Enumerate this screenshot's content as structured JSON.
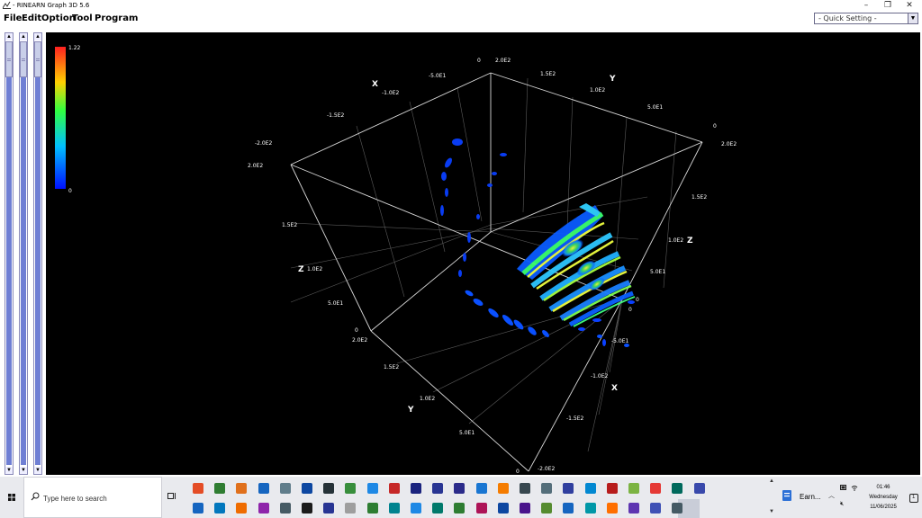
{
  "window": {
    "title": "- RINEARN Graph 3D 5.6",
    "minimize_glyph": "–",
    "maximize_glyph": "❐",
    "close_glyph": "✕"
  },
  "menu": {
    "items": [
      "File",
      "Edit",
      "Option",
      "Tool",
      "Program"
    ]
  },
  "quick_setting": {
    "value": "- Quick Setting -"
  },
  "colorbar": {
    "max_label": "1.22",
    "min_label": "0"
  },
  "axes": {
    "x_title": "X",
    "y_title": "Y",
    "z_title": "Z",
    "top_x_ticks": [
      "-2.0E2",
      "-1.5E2",
      "-1.0E2",
      "-5.0E1",
      "0"
    ],
    "top_y_ticks": [
      "2.0E2",
      "1.5E2",
      "1.0E2",
      "5.0E1",
      "0"
    ],
    "left_z_ticks": [
      "2.0E2",
      "1.5E2",
      "1.0E2",
      "5.0E1",
      "0"
    ],
    "right_z_ticks": [
      "2.0E2",
      "1.5E2",
      "1.0E2",
      "5.0E1",
      "0"
    ],
    "bottom_y_ticks": [
      "2.0E2",
      "1.5E2",
      "1.0E2",
      "5.0E1",
      "0"
    ],
    "bottom_x_ticks": [
      "0",
      "-5.0E1",
      "-1.0E2",
      "-1.5E2",
      "-2.0E2"
    ]
  },
  "taskbar": {
    "search_placeholder": "Type here to search",
    "active_app_label": "Earn...",
    "time": "01:46",
    "day": "Wednesday",
    "date": "11/06/2025",
    "notification_count": "1",
    "row1_icon_colors": [
      "#e44d26",
      "#2f7d32",
      "#e0701c",
      "#1565c0",
      "#607d8b",
      "#0d47a1",
      "#263238",
      "#388e3c",
      "#1e88e5",
      "#c62828",
      "#1a237e",
      "#283593",
      "#2b2b8a",
      "#1976d2",
      "#f57c00",
      "#37474f",
      "#546e7a",
      "#303f9f",
      "#0288d1",
      "#b71c1c",
      "#7cb342",
      "#e53935",
      "#00695c",
      "#3949ab"
    ],
    "row2_icon_colors": [
      "#1565c0",
      "#0277bd",
      "#ef6c00",
      "#8e24aa",
      "#455a64",
      "#1b1b1b",
      "#283593",
      "#9e9e9e",
      "#2e7d32",
      "#00838f",
      "#1e88e5",
      "#00796b",
      "#2e7d32",
      "#ad1457",
      "#0d47a1",
      "#4a148c",
      "#558b2f",
      "#1565c0",
      "#0097a7",
      "#ff6f00",
      "#5e35b1",
      "#3f51b5",
      "#455a64"
    ]
  }
}
